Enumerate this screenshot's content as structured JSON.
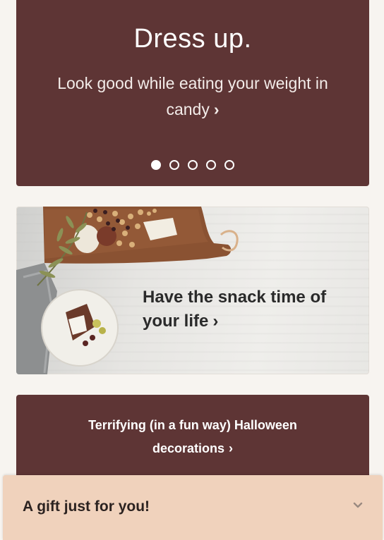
{
  "hero": {
    "title": "Dress up.",
    "subtitle": "Look good while eating your weight in candy",
    "chevron": "›",
    "carousel": {
      "slide_count": 5,
      "active_index": 0
    },
    "background_color": "#5e3535"
  },
  "snack_banner": {
    "text": "Have the snack time of your life",
    "chevron": "›"
  },
  "halloween_banner": {
    "text": "Terrifying (in a fun way) Halloween decorations",
    "chevron": "›",
    "background_color": "#5e3535"
  },
  "gift_drawer": {
    "label": "A gift just for you!",
    "icon": "chevron-down-icon",
    "background_color": "#f0d2bc"
  }
}
